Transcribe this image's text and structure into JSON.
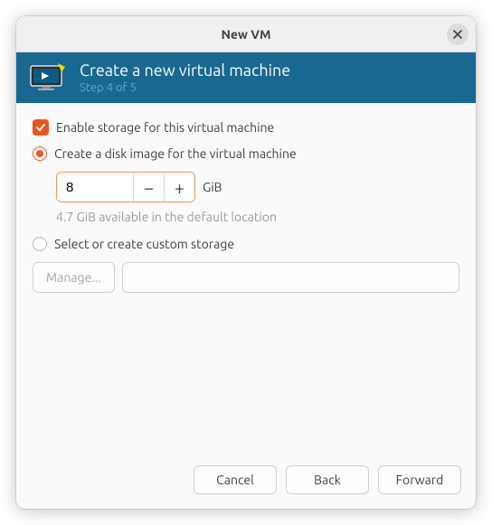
{
  "window": {
    "title": "New VM"
  },
  "header": {
    "title": "Create a new virtual machine",
    "subtitle": "Step 4 of 5"
  },
  "storage": {
    "enable_label": "Enable storage for this virtual machine",
    "create_image_label": "Create a disk image for the virtual machine",
    "size_value": "8",
    "size_unit": "GiB",
    "available_hint": "4.7 GiB available in the default location",
    "custom_label": "Select or create custom storage",
    "manage_button": "Manage...",
    "custom_path": ""
  },
  "buttons": {
    "cancel": "Cancel",
    "back": "Back",
    "forward": "Forward"
  },
  "colors": {
    "accent": "#e95420",
    "header_bg": "#186891"
  }
}
